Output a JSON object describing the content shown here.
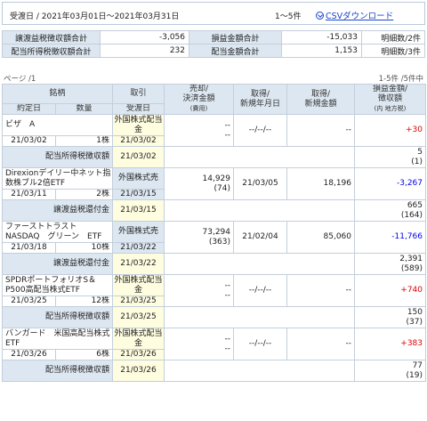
{
  "header": {
    "period": "受渡日 / 2021年03月01日〜2021年03月31日",
    "count": "1〜5件",
    "csv_label": "CSVダウンロード"
  },
  "summary": [
    {
      "l1": "譲渡益税徴収額合計",
      "v1": "-3,056",
      "l2": "損益金額合計",
      "v2": "-15,033",
      "c3": "明細数/2件"
    },
    {
      "l1": "配当所得税徴収額合計",
      "v1": "232",
      "l2": "配当金額合計",
      "v2": "1,153",
      "c3": "明細数/3件"
    }
  ],
  "page": {
    "left": "ページ /1",
    "right": "1-5件 /5件中"
  },
  "columns": {
    "stock": "銘柄",
    "trade": "取引",
    "sell1": "売却/",
    "sell2": "決済金額",
    "sell3": "(費用)",
    "acq1": "取得/",
    "acq2": "新規年月日",
    "acqamt1": "取得/",
    "acqamt2": "新規金額",
    "pl1": "損益金額/",
    "pl2": "徴収額",
    "pl3": "(内 地方税)",
    "contract_date": "約定日",
    "qty": "数量",
    "settle_date": "受渡日"
  },
  "rows": [
    {
      "name": "ビザ　A",
      "trade": "外国株式配当金",
      "sell": "--",
      "fee": "--",
      "acq_date": "--/--/--",
      "acq_amt": "--",
      "pl": "+30",
      "contract": "21/03/02",
      "qty": "1株",
      "settle": "21/03/02",
      "tax_label": "配当所得税徴収額",
      "tax_date": "21/03/02",
      "tax": "5",
      "tax_local": "(1)"
    },
    {
      "name": "Direxionデイリー中ネット指数株ブル2倍ETF",
      "trade": "外国株式売",
      "sell": "14,929",
      "fee": "(74)",
      "acq_date": "21/03/05",
      "acq_amt": "18,196",
      "pl": "-3,267",
      "contract": "21/03/11",
      "qty": "2株",
      "settle": "21/03/15",
      "tax_label": "譲渡益税還付金",
      "tax_date": "21/03/15",
      "tax": "665",
      "tax_local": "(164)"
    },
    {
      "name": "ファーストトラスト　NASDAQ　グリーン　ETF",
      "trade": "外国株式売",
      "sell": "73,294",
      "fee": "(363)",
      "acq_date": "21/02/04",
      "acq_amt": "85,060",
      "pl": "-11,766",
      "contract": "21/03/18",
      "qty": "10株",
      "settle": "21/03/22",
      "tax_label": "譲渡益税還付金",
      "tax_date": "21/03/22",
      "tax": "2,391",
      "tax_local": "(589)"
    },
    {
      "name": "SPDRポートフォリオS＆P500高配当株式ETF",
      "trade": "外国株式配当金",
      "sell": "--",
      "fee": "--",
      "acq_date": "--/--/--",
      "acq_amt": "--",
      "pl": "+740",
      "contract": "21/03/25",
      "qty": "12株",
      "settle": "21/03/25",
      "tax_label": "配当所得税徴収額",
      "tax_date": "21/03/25",
      "tax": "150",
      "tax_local": "(37)"
    },
    {
      "name": "バンガード　米国高配当株式ETF",
      "trade": "外国株式配当金",
      "sell": "--",
      "fee": "--",
      "acq_date": "--/--/--",
      "acq_amt": "--",
      "pl": "+383",
      "contract": "21/03/26",
      "qty": "6株",
      "settle": "21/03/26",
      "tax_label": "配当所得税徴収額",
      "tax_date": "21/03/26",
      "tax": "77",
      "tax_local": "(19)"
    }
  ],
  "colors": {
    "header_bg": "#dde7f1",
    "highlight_bg": "#fffde0",
    "profit": "#e00000",
    "loss": "#0000ee",
    "link": "#1a46c8"
  }
}
